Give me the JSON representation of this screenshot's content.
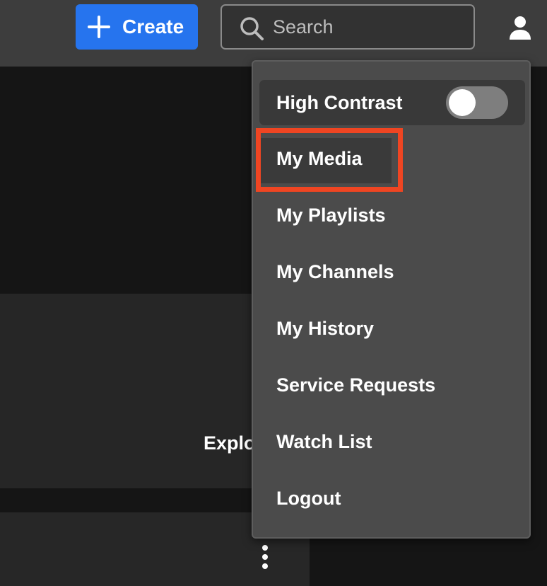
{
  "header": {
    "create_label": "Create",
    "search": {
      "placeholder": "Search",
      "value": ""
    },
    "icons": {
      "create": "plus-icon",
      "search": "search-icon",
      "user": "user-icon"
    }
  },
  "background": {
    "card_title_partial": "Explo",
    "card_menu_icon": "more-vertical-icon"
  },
  "user_menu": {
    "high_contrast": {
      "label": "High Contrast",
      "enabled": false
    },
    "items": [
      {
        "label": "My Media",
        "highlighted": true
      },
      {
        "label": "My Playlists"
      },
      {
        "label": "My Channels"
      },
      {
        "label": "My History"
      },
      {
        "label": "Service Requests"
      },
      {
        "label": "Watch List"
      },
      {
        "label": "Logout"
      }
    ]
  },
  "colors": {
    "header_bg": "#3d3d3d",
    "accent_blue": "#2674ee",
    "menu_bg": "#4b4b4b",
    "highlight_box": "#ef4522",
    "page_bg": "#151515"
  }
}
